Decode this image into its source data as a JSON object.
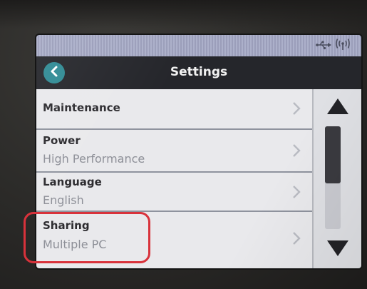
{
  "status_bar": {
    "icons": [
      "usb-icon",
      "wireless-icon"
    ]
  },
  "header": {
    "title": "Settings",
    "back_icon": "chevron-left-icon"
  },
  "settings_list": {
    "items": [
      {
        "label": "Maintenance",
        "value": ""
      },
      {
        "label": "Power",
        "value": "High Performance"
      },
      {
        "label": "Language",
        "value": "English"
      },
      {
        "label": "Sharing",
        "value": "Multiple PC"
      }
    ]
  },
  "scrollbar": {
    "up_icon": "triangle-up-icon",
    "down_icon": "triangle-down-icon",
    "position_fraction": 0
  },
  "colors": {
    "status_bar": "#a3a7c4",
    "header": "#25262b",
    "back_button": "#2f8a94",
    "list_background": "#e9e9ec",
    "highlight": "#d8323b"
  }
}
